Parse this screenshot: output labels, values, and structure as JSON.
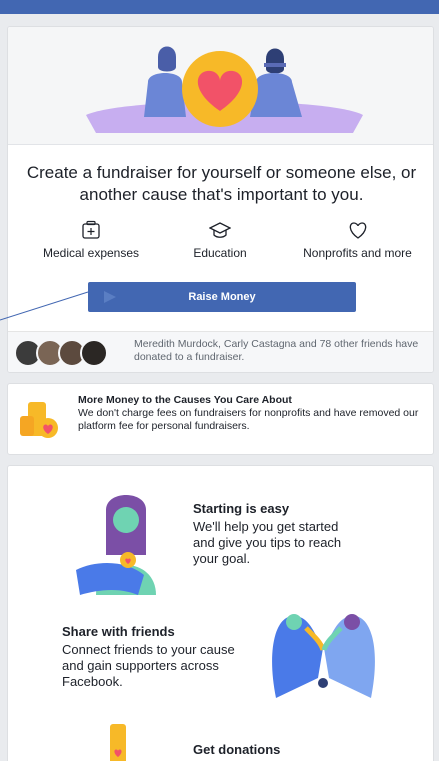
{
  "headline": "Create a fundraiser for yourself or someone else, or another cause that's important to you.",
  "categories": [
    {
      "label": "Medical expenses",
      "icon": "medical-kit-icon"
    },
    {
      "label": "Education",
      "icon": "graduation-cap-icon"
    },
    {
      "label": "Nonprofits and more",
      "icon": "heart-outline-icon"
    }
  ],
  "raise_button": "Raise Money",
  "friends_donated": "Meredith Murdock, Carly Castagna and 78 other friends have donated to a fundraiser.",
  "fees": {
    "title": "More Money to the Causes You Care About",
    "description": "We don't charge fees on fundraisers for nonprofits and have removed our platform fee for personal fundraisers."
  },
  "features": [
    {
      "title": "Starting is easy",
      "description": "We'll help you get started and give you tips to reach your goal."
    },
    {
      "title": "Share with friends",
      "description": "Connect friends to your cause and gain supporters across Facebook."
    },
    {
      "title": "Get donations",
      "description": ""
    }
  ],
  "colors": {
    "brand": "#4267b2",
    "heart": "#f25268",
    "coin": "#f7b928"
  }
}
